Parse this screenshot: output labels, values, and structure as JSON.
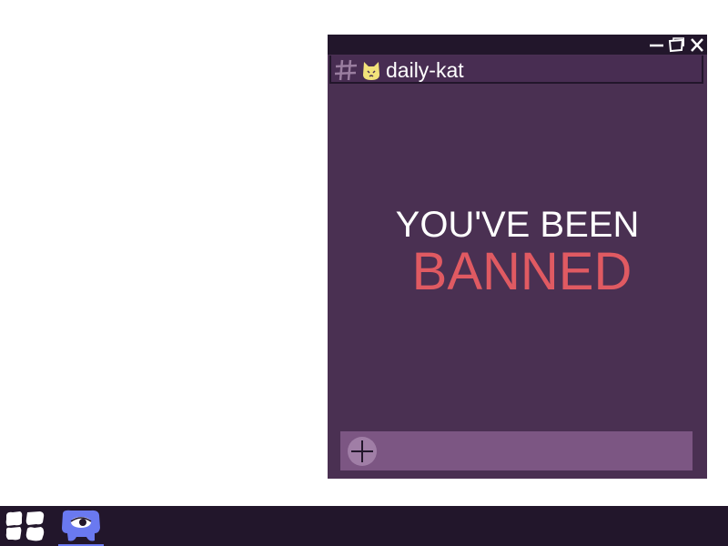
{
  "window": {
    "controls": {
      "minimize_icon": "minimize-icon",
      "maximize_icon": "maximize-icon",
      "close_icon": "close-icon"
    }
  },
  "channel": {
    "hash_icon": "hash-icon",
    "cat_icon": "cat-face-icon",
    "name": "daily-kat"
  },
  "message": {
    "line1": "YOU'VE BEEN",
    "line2": "BANNED"
  },
  "composer": {
    "add_icon": "plus-circle-icon",
    "value": "",
    "placeholder": ""
  },
  "taskbar": {
    "start_icon": "start-menu-icon",
    "apps": [
      {
        "icon": "chat-app-icon",
        "active": true
      }
    ]
  },
  "colors": {
    "titlebar": "#22162b",
    "window_bg": "#4a3052",
    "composer_bg": "#7c5683",
    "ban_red": "#e05a62",
    "accent_blue": "#6a79f0",
    "cat_yellow": "#f2e27a"
  }
}
